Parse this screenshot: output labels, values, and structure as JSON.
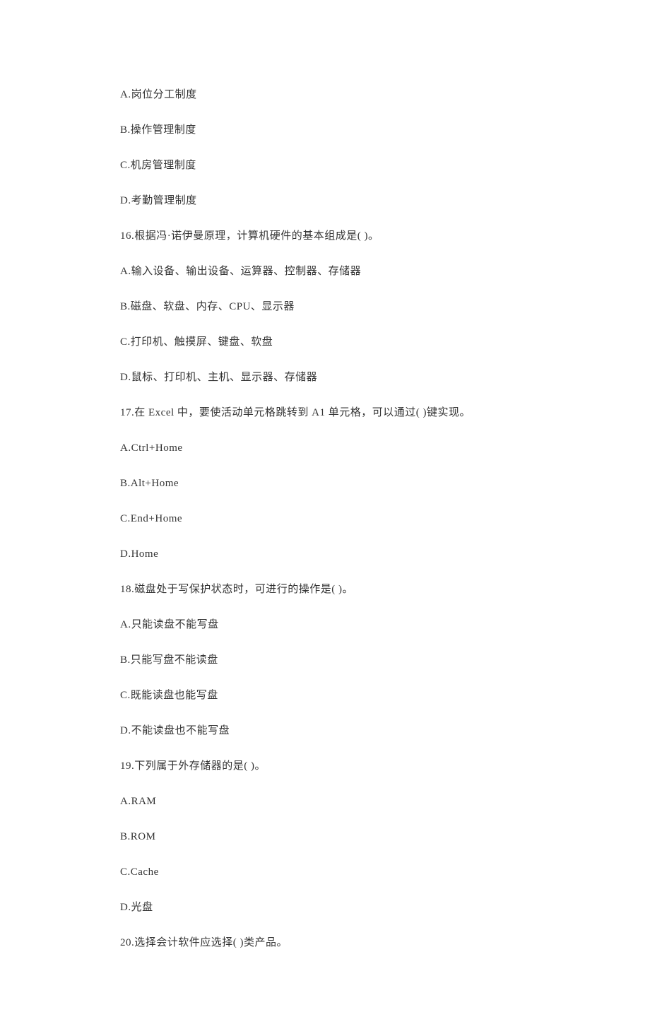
{
  "lines": [
    "A.岗位分工制度",
    "B.操作管理制度",
    "C.机房管理制度",
    "D.考勤管理制度",
    "16.根据冯·诺伊曼原理，计算机硬件的基本组成是(  )。",
    "A.输入设备、输出设备、运算器、控制器、存储器",
    "B.磁盘、软盘、内存、CPU、显示器",
    "C.打印机、触摸屏、键盘、软盘",
    "D.鼠标、打印机、主机、显示器、存储器",
    "17.在 Excel 中，要使活动单元格跳转到 A1 单元格，可以通过(  )键实现。",
    "A.Ctrl+Home",
    "B.Alt+Home",
    "C.End+Home",
    "D.Home",
    "18.磁盘处于写保护状态时，可进行的操作是(  )。",
    "A.只能读盘不能写盘",
    "B.只能写盘不能读盘",
    "C.既能读盘也能写盘",
    "D.不能读盘也不能写盘",
    "19.下列属于外存储器的是(  )。",
    "A.RAM",
    "B.ROM",
    "C.Cache",
    "D.光盘",
    "20.选择会计软件应选择(  )类产品。"
  ]
}
